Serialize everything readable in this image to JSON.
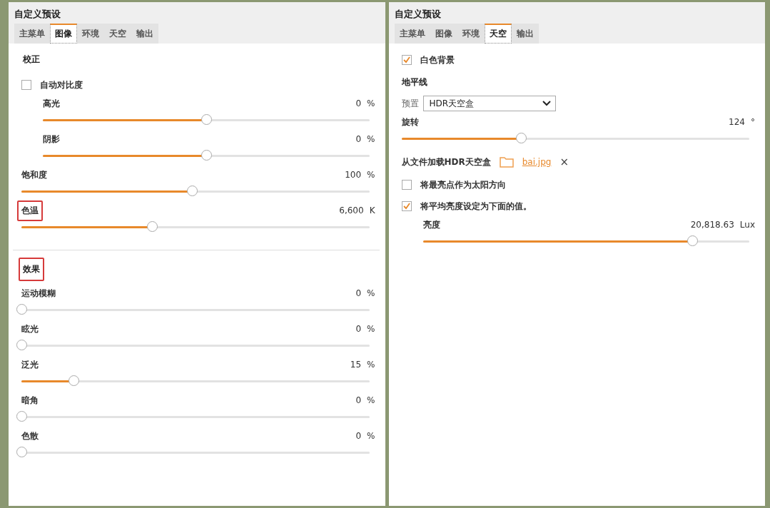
{
  "panels": [
    {
      "title": "自定义预设",
      "tabs": [
        {
          "label": "主菜单",
          "selected": false
        },
        {
          "label": "图像",
          "selected": true
        },
        {
          "label": "环境",
          "selected": false
        },
        {
          "label": "天空",
          "selected": false
        },
        {
          "label": "输出",
          "selected": false
        }
      ],
      "sections": [
        {
          "title": "校正",
          "highlighted": false,
          "items": [
            {
              "kind": "checkbox",
              "label": "自动对比度",
              "checked": false,
              "children": [
                {
                  "kind": "slider",
                  "label": "高光",
                  "value": "0",
                  "unit": "%",
                  "level": 0.5,
                  "highlighted": false
                },
                {
                  "kind": "slider",
                  "label": "阴影",
                  "value": "0",
                  "unit": "%",
                  "level": 0.5,
                  "highlighted": false
                }
              ]
            },
            {
              "kind": "slider",
              "label": "饱和度",
              "value": "100",
              "unit": "%",
              "level": 0.49,
              "highlighted": false
            },
            {
              "kind": "slider",
              "label": "色温",
              "value": "6,600",
              "unit": "K",
              "level": 0.375,
              "highlighted": true
            }
          ]
        },
        {
          "title": "效果",
          "highlighted": true,
          "items": [
            {
              "kind": "slider",
              "label": "运动模糊",
              "value": "0",
              "unit": "%",
              "level": 0,
              "highlighted": false
            },
            {
              "kind": "slider",
              "label": "眩光",
              "value": "0",
              "unit": "%",
              "level": 0,
              "highlighted": false
            },
            {
              "kind": "slider",
              "label": "泛光",
              "value": "15",
              "unit": "%",
              "level": 0.15,
              "highlighted": false
            },
            {
              "kind": "slider",
              "label": "暗角",
              "value": "0",
              "unit": "%",
              "level": 0,
              "highlighted": false
            },
            {
              "kind": "slider",
              "label": "色散",
              "value": "0",
              "unit": "%",
              "level": 0,
              "highlighted": false
            }
          ]
        }
      ]
    },
    {
      "title": "自定义预设",
      "tabs": [
        {
          "label": "主菜单",
          "selected": false
        },
        {
          "label": "图像",
          "selected": false
        },
        {
          "label": "环境",
          "selected": false
        },
        {
          "label": "天空",
          "selected": true
        },
        {
          "label": "输出",
          "selected": false
        }
      ],
      "sections": [
        {
          "items": [
            {
              "kind": "checkbox",
              "label": "白色背景",
              "checked": true
            },
            {
              "kind": "heading",
              "label": "地平线"
            },
            {
              "kind": "select",
              "label": "预置",
              "value": "HDR天空盒"
            },
            {
              "kind": "slider",
              "label": "旋转",
              "value": "124",
              "unit": "°",
              "level": 0.343,
              "highlighted": false
            },
            {
              "kind": "file",
              "label": "从文件加载HDR天空盒",
              "file": "bai.jpg",
              "clear": "×"
            },
            {
              "kind": "checkbox",
              "label": "将最亮点作为太阳方向",
              "checked": false
            },
            {
              "kind": "checkbox",
              "label": "将平均亮度设定为下面的值。",
              "checked": true,
              "children": [
                {
                  "kind": "slider",
                  "label": "亮度",
                  "value": "20,818.63",
                  "unit": "Lux",
                  "level": 0.826,
                  "highlighted": false
                }
              ]
            }
          ]
        }
      ]
    }
  ]
}
